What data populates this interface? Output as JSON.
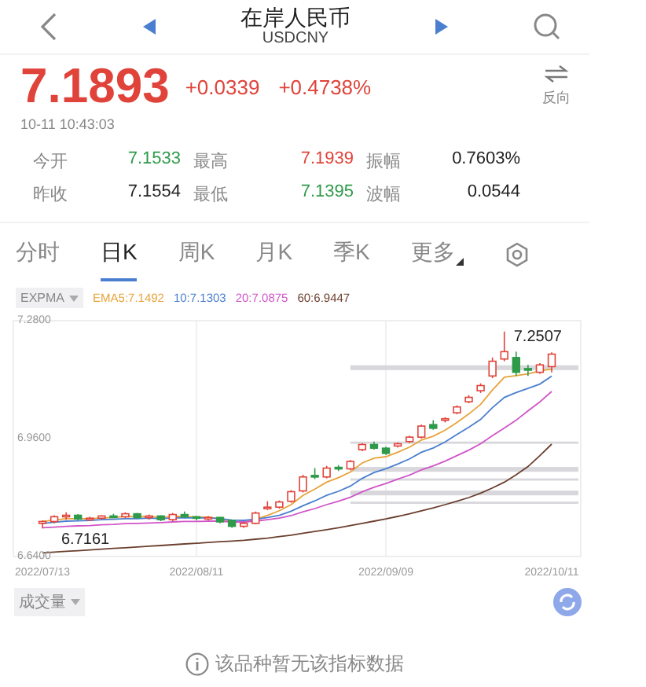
{
  "header": {
    "title": "在岸人民币",
    "subtitle": "USDCNY"
  },
  "quote": {
    "price": "7.1893",
    "change": "+0.0339",
    "change_pct": "+0.4738%",
    "reverse_label": "反向",
    "time": "10-11 10:43:03"
  },
  "stats": [
    {
      "label": "今开",
      "value": "7.1533",
      "color": "#2e9a4a"
    },
    {
      "label": "最高",
      "value": "7.1939",
      "color": "#e0433a"
    },
    {
      "label": "振幅",
      "value": "0.7603%",
      "color": "#222222"
    },
    {
      "label": "昨收",
      "value": "7.1554",
      "color": "#222222"
    },
    {
      "label": "最低",
      "value": "7.1395",
      "color": "#2e9a4a"
    },
    {
      "label": "波幅",
      "value": "0.0544",
      "color": "#222222"
    }
  ],
  "tabs": [
    {
      "label": "分时",
      "selected": false
    },
    {
      "label": "日K",
      "selected": true
    },
    {
      "label": "周K",
      "selected": false
    },
    {
      "label": "月K",
      "selected": false
    },
    {
      "label": "季K",
      "selected": false
    },
    {
      "label": "更多",
      "selected": false,
      "dropdown": true
    }
  ],
  "indicator": {
    "label": "EXPMA"
  },
  "chart_data": {
    "type": "candlestick",
    "categories": [
      "2022/07/13",
      null,
      null,
      null,
      null,
      null,
      null,
      null,
      null,
      null,
      null,
      null,
      null,
      "2022/08/11",
      null,
      null,
      null,
      null,
      null,
      null,
      null,
      null,
      null,
      null,
      null,
      null,
      null,
      null,
      null,
      "2022/09/09",
      null,
      null,
      null,
      null,
      null,
      null,
      null,
      null,
      null,
      null,
      null,
      null,
      null,
      "2022/10/11"
    ],
    "ohlc": [
      [
        6.73,
        6.738,
        6.7161,
        6.735
      ],
      [
        6.735,
        6.752,
        6.73,
        6.748
      ],
      [
        6.748,
        6.76,
        6.74,
        6.752
      ],
      [
        6.752,
        6.755,
        6.738,
        6.742
      ],
      [
        6.742,
        6.748,
        6.736,
        6.744
      ],
      [
        6.744,
        6.752,
        6.74,
        6.75
      ],
      [
        6.75,
        6.756,
        6.745,
        6.748
      ],
      [
        6.748,
        6.76,
        6.744,
        6.756
      ],
      [
        6.756,
        6.758,
        6.742,
        6.746
      ],
      [
        6.746,
        6.754,
        6.74,
        6.75
      ],
      [
        6.75,
        6.752,
        6.736,
        6.74
      ],
      [
        6.74,
        6.758,
        6.736,
        6.754
      ],
      [
        6.754,
        6.762,
        6.744,
        6.748
      ],
      [
        6.748,
        6.75,
        6.738,
        6.744
      ],
      [
        6.744,
        6.75,
        6.738,
        6.746
      ],
      [
        6.746,
        6.748,
        6.73,
        6.734
      ],
      [
        6.738,
        6.74,
        6.718,
        6.722
      ],
      [
        6.722,
        6.734,
        6.718,
        6.73
      ],
      [
        6.73,
        6.762,
        6.728,
        6.758
      ],
      [
        6.77,
        6.79,
        6.766,
        6.774
      ],
      [
        6.774,
        6.792,
        6.77,
        6.788
      ],
      [
        6.79,
        6.82,
        6.786,
        6.816
      ],
      [
        6.818,
        6.862,
        6.814,
        6.856
      ],
      [
        6.86,
        6.88,
        6.85,
        6.856
      ],
      [
        6.856,
        6.886,
        6.852,
        6.88
      ],
      [
        6.882,
        6.888,
        6.872,
        6.878
      ],
      [
        6.878,
        6.902,
        6.874,
        6.898
      ],
      [
        6.93,
        6.948,
        6.926,
        6.944
      ],
      [
        6.944,
        6.952,
        6.93,
        6.934
      ],
      [
        6.934,
        6.938,
        6.916,
        6.92
      ],
      [
        6.94,
        6.95,
        6.936,
        6.946
      ],
      [
        6.952,
        6.968,
        6.948,
        6.964
      ],
      [
        6.964,
        6.998,
        6.96,
        6.994
      ],
      [
        6.998,
        7.01,
        6.984,
        6.988
      ],
      [
        7.01,
        7.018,
        7.004,
        7.014
      ],
      [
        7.03,
        7.05,
        7.026,
        7.046
      ],
      [
        7.06,
        7.078,
        7.056,
        7.072
      ],
      [
        7.09,
        7.11,
        7.084,
        7.104
      ],
      [
        7.13,
        7.18,
        7.124,
        7.17
      ],
      [
        7.176,
        7.2507,
        7.17,
        7.196
      ],
      [
        7.18,
        7.196,
        7.13,
        7.14
      ],
      [
        7.15,
        7.16,
        7.13,
        7.146
      ],
      [
        7.14,
        7.165,
        7.136,
        7.16
      ],
      [
        7.1554,
        7.1939,
        7.1395,
        7.1893
      ]
    ],
    "series": [
      {
        "name": "EMA5:7.1492",
        "type": "line",
        "color": "#e8a33a",
        "values": [
          6.735,
          6.739,
          6.743,
          6.743,
          6.743,
          6.745,
          6.746,
          6.749,
          6.748,
          6.749,
          6.746,
          6.749,
          6.749,
          6.747,
          6.747,
          6.743,
          6.734,
          6.733,
          6.741,
          6.752,
          6.764,
          6.781,
          6.806,
          6.823,
          6.842,
          6.854,
          6.869,
          6.894,
          6.907,
          6.911,
          6.923,
          6.937,
          6.956,
          6.967,
          6.983,
          7.004,
          7.027,
          7.053,
          7.092,
          7.127,
          7.131,
          7.136,
          7.144,
          7.149
        ]
      },
      {
        "name": "10:7.1303",
        "type": "line",
        "color": "#4a7fd0",
        "values": [
          6.73,
          6.733,
          6.736,
          6.737,
          6.738,
          6.74,
          6.741,
          6.743,
          6.743,
          6.744,
          6.743,
          6.745,
          6.745,
          6.745,
          6.745,
          6.743,
          6.739,
          6.738,
          6.741,
          6.746,
          6.752,
          6.763,
          6.778,
          6.791,
          6.806,
          6.817,
          6.831,
          6.852,
          6.868,
          6.878,
          6.891,
          6.905,
          6.923,
          6.935,
          6.951,
          6.971,
          6.991,
          7.012,
          7.044,
          7.072,
          7.085,
          7.096,
          7.108,
          7.13
        ]
      },
      {
        "name": "20:7.0875",
        "type": "line",
        "color": "#d055c8",
        "values": [
          6.718,
          6.72,
          6.722,
          6.723,
          6.724,
          6.726,
          6.727,
          6.729,
          6.73,
          6.731,
          6.732,
          6.734,
          6.735,
          6.735,
          6.736,
          6.736,
          6.734,
          6.734,
          6.736,
          6.74,
          6.744,
          6.751,
          6.761,
          6.77,
          6.781,
          6.79,
          6.801,
          6.816,
          6.828,
          6.838,
          6.85,
          6.861,
          6.875,
          6.886,
          6.899,
          6.914,
          6.929,
          6.946,
          6.968,
          6.989,
          7.01,
          7.035,
          7.06,
          7.088
        ]
      },
      {
        "name": "60:6.9447",
        "type": "line",
        "color": "#6b3f2e",
        "values": [
          6.65,
          6.652,
          6.654,
          6.656,
          6.658,
          6.66,
          6.662,
          6.664,
          6.666,
          6.668,
          6.67,
          6.672,
          6.674,
          6.676,
          6.678,
          6.68,
          6.682,
          6.684,
          6.687,
          6.69,
          6.694,
          6.698,
          6.703,
          6.708,
          6.713,
          6.718,
          6.724,
          6.73,
          6.736,
          6.742,
          6.749,
          6.756,
          6.764,
          6.772,
          6.781,
          6.79,
          6.8,
          6.812,
          6.826,
          6.842,
          6.862,
          6.884,
          6.914,
          6.945
        ]
      }
    ],
    "ylim": [
      6.64,
      7.28
    ],
    "yticks": [
      {
        "value": 7.28,
        "label": "7.2800"
      },
      {
        "value": 6.96,
        "label": "6.9600"
      },
      {
        "value": 6.64,
        "label": "6.6400"
      }
    ],
    "bands": [
      {
        "axis": "y",
        "from": 7.146,
        "to": 7.159
      },
      {
        "axis": "y",
        "from": 6.946,
        "to": 6.952
      },
      {
        "axis": "y",
        "from": 6.87,
        "to": 6.883
      },
      {
        "axis": "y",
        "from": 6.846,
        "to": 6.852
      },
      {
        "axis": "y",
        "from": 6.806,
        "to": 6.819
      },
      {
        "axis": "y",
        "from": 6.783,
        "to": 6.789
      }
    ],
    "annotations": [
      {
        "text": "7.2507"
      },
      {
        "text": "6.7161"
      }
    ]
  },
  "volume": {
    "label": "成交量"
  },
  "notice": "该品种暂无该指标数据"
}
